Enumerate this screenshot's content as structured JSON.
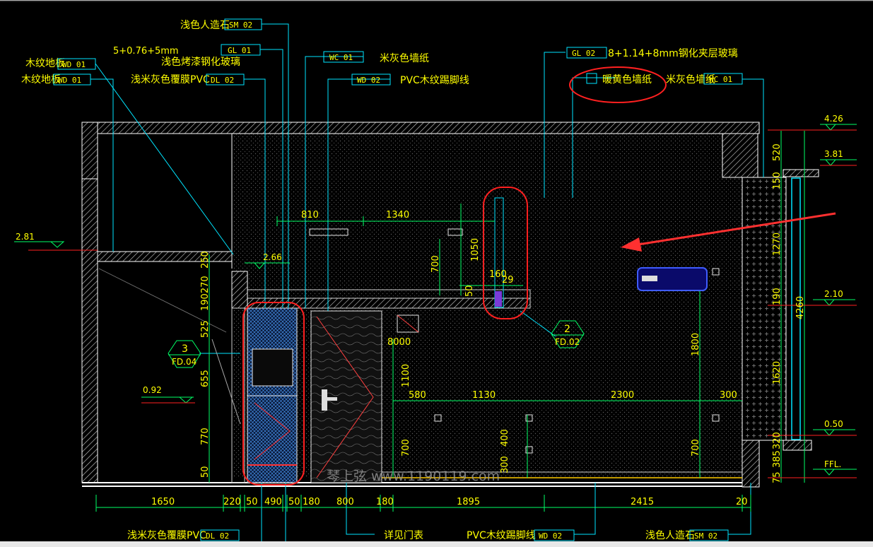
{
  "callouts_top": {
    "c1": "浅色人造石",
    "c1_code": "SM 02",
    "c2_spec": "5+0.76+5mm",
    "c2": "浅色烤漆钢化玻璃",
    "c2_code": "GL 01",
    "c3_code": "WC 01",
    "c3": "米灰色墙纸",
    "c4_code": "WD 02",
    "c4": "PVC木纹踢脚线",
    "c5_code": "GL 02",
    "c5": "8+1.14+8mm钢化夹层玻璃",
    "c6": "米灰色墙纸",
    "c6_code": "WC 01",
    "c7": "暖黄色墙纸",
    "c8": "木纹地板",
    "c8_code": "WD 01",
    "c9": "木纹地板",
    "c9_code": "WD 01",
    "c10": "浅米灰色覆膜PVC",
    "c10_code": "DL 02"
  },
  "callouts_bottom": {
    "b1": "浅米灰色覆膜PVC",
    "b1_code": "DL 02",
    "b2": "详见门表",
    "b3": "PVC木纹踢脚线",
    "b3_code": "WD 02",
    "b4": "浅色人造石",
    "b4_code": "SM 02"
  },
  "levels": {
    "l426": "4.26",
    "l381": "3.81",
    "l281": "2.81",
    "l266": "2.66",
    "l210": "2.10",
    "l092": "0.92",
    "l050": "0.50",
    "lffl": "FFL."
  },
  "dims_bottom": [
    "1650",
    "220",
    "50",
    "490",
    "50",
    "180",
    "800",
    "180",
    "1895",
    "2415",
    "20"
  ],
  "dims_inner": {
    "d810": "810",
    "d1340": "1340",
    "d1050": "1050",
    "d700a": "700",
    "d50": "50",
    "d160": "160",
    "d29": "29",
    "d8000": "8000",
    "d1100": "1100",
    "d580": "580",
    "d1130": "1130",
    "d2300": "2300",
    "d300": "300",
    "d1800": "1800",
    "d700b": "700",
    "d400": "400",
    "d300b": "300",
    "d700c": "700",
    "d250": "250",
    "d190270": "190270",
    "d525": "525",
    "d655": "655",
    "d770": "770",
    "d50b": "50"
  },
  "dims_right": [
    "520",
    "150",
    "1270",
    "190",
    "1620",
    "320",
    "75",
    "385",
    "4260"
  ],
  "section_marks": {
    "s3_num": "3",
    "s3_ref": "FD.04",
    "s2_num": "2",
    "s2_ref": "FD.02"
  },
  "watermark": "琴上弦 www.1190119.com",
  "colors": {
    "background": "#000000",
    "text": "#ffff00",
    "leader": "#00ffff",
    "dimension": "#00ff00",
    "wall": "#ffffff",
    "markup": "#ff2020",
    "arrow": "#ff3030",
    "ac_unit": "#3344ff"
  }
}
